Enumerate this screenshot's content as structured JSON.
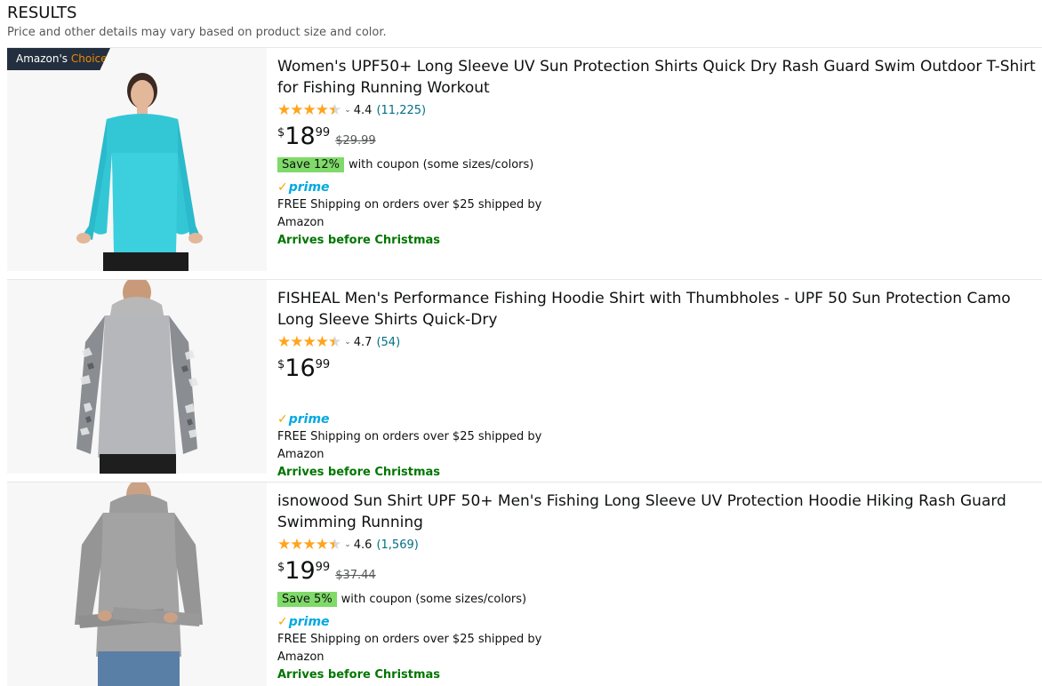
{
  "header": {
    "title": "RESULTS",
    "subtitle": "Price and other details may vary based on product size and color."
  },
  "badge": {
    "label_1": "Amazon's",
    "label_2": "Choice"
  },
  "products": [
    {
      "title": "Women's UPF50+ Long Sleeve UV Sun Protection Shirts Quick Dry Rash Guard Swim Outdoor T-Shirt for Fishing Running Workout",
      "rating": "4.4",
      "rating_count": "(11,225)",
      "price_symbol": "$",
      "price_whole": "18",
      "price_fraction": "99",
      "list_price": "$29.99",
      "coupon_tag": "Save 12%",
      "coupon_text": "with coupon (some sizes/colors)",
      "prime_label": "prime",
      "shipping": "FREE Shipping on orders over $25 shipped by Amazon",
      "arrival": "Arrives before Christmas"
    },
    {
      "title": "FISHEAL Men's Performance Fishing Hoodie Shirt with Thumbholes - UPF 50 Sun Protection Camo Long Sleeve Shirts Quick-Dry",
      "rating": "4.7",
      "rating_count": "(54)",
      "price_symbol": "$",
      "price_whole": "16",
      "price_fraction": "99",
      "prime_label": "prime",
      "shipping": "FREE Shipping on orders over $25 shipped by Amazon",
      "arrival": "Arrives before Christmas"
    },
    {
      "title": "isnowood Sun Shirt UPF 50+ Men's Fishing Long Sleeve UV Protection Hoodie Hiking Rash Guard Swimming Running",
      "rating": "4.6",
      "rating_count": "(1,569)",
      "price_symbol": "$",
      "price_whole": "19",
      "price_fraction": "99",
      "list_price": "$37.44",
      "coupon_tag": "Save 5%",
      "coupon_text": "with coupon (some sizes/colors)",
      "prime_label": "prime",
      "shipping": "FREE Shipping on orders over $25 shipped by Amazon",
      "arrival": "Arrives before Christmas"
    }
  ],
  "colors": {
    "star": "#ffa41c",
    "link": "#007185",
    "prime": "#00a8e1",
    "arrival": "#007600",
    "coupon_bg": "#7fda69",
    "badge_bg": "#232f3e"
  }
}
